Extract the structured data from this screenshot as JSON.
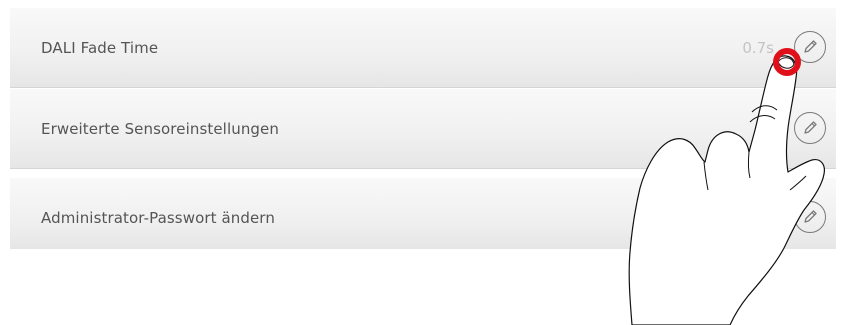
{
  "settings": {
    "rows": [
      {
        "label": "DALI Fade Time",
        "value": "0.7s",
        "edit_icon": "pencil-icon"
      },
      {
        "label": "Erweiterte Sensoreinstellungen",
        "edit_icon": "pencil-icon"
      },
      {
        "label": "Administrator-Passwort ändern",
        "edit_icon": "pencil-icon"
      }
    ]
  },
  "overlay": {
    "gesture": "tap",
    "touch_indicator_color": "#e0101a"
  }
}
